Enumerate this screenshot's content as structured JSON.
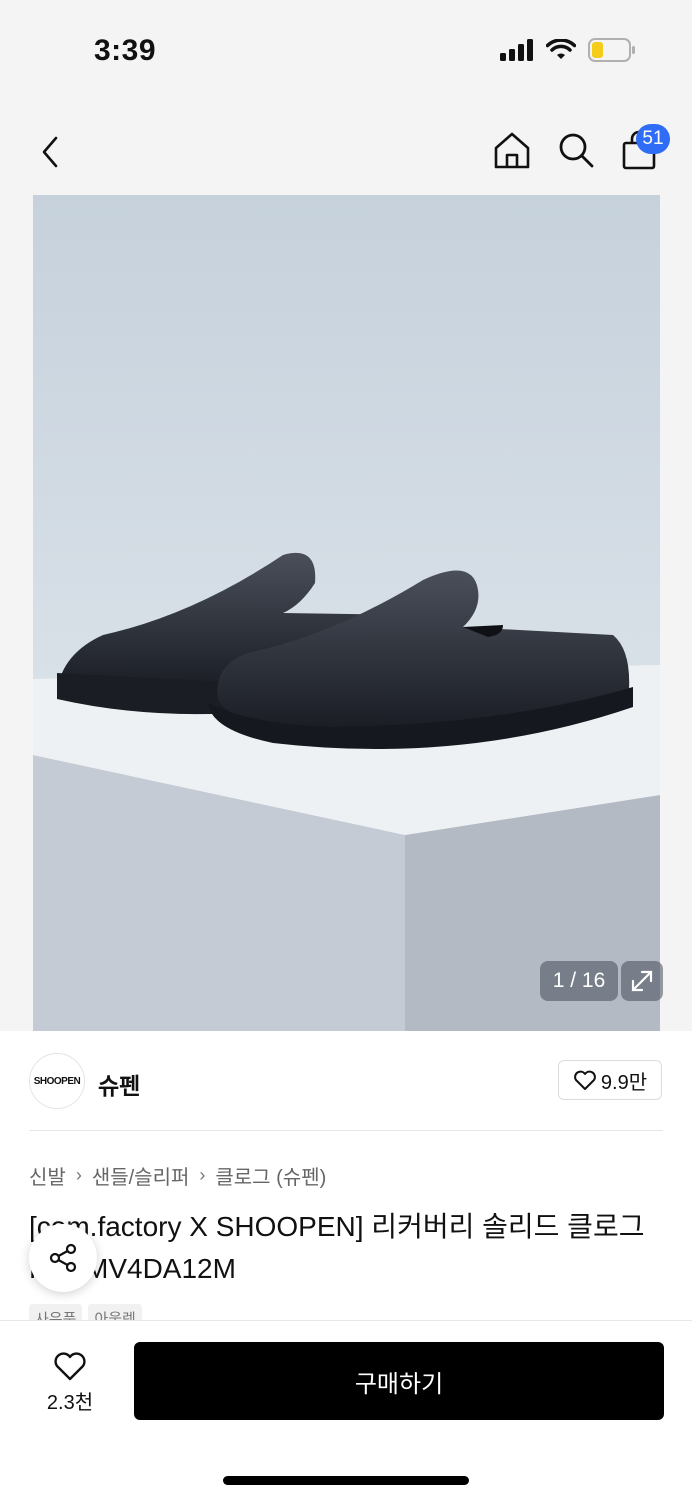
{
  "status": {
    "time": "3:39"
  },
  "nav": {
    "back_icon": "chevron-left-icon",
    "home_icon": "home-icon",
    "search_icon": "search-icon",
    "cart_icon": "shopping-bag-icon",
    "cart_count": "51",
    "badge_color": "#2f6df6"
  },
  "gallery": {
    "counter": "1 / 16",
    "expand_icon": "expand-arrows-icon"
  },
  "brand": {
    "logo_text": "SHOOPEN",
    "name": "슈펜",
    "likes": "9.9만"
  },
  "breadcrumb": [
    "신발",
    "샌들/슬리퍼",
    "클로그 (슈펜)"
  ],
  "product": {
    "title": "[com.factory X SHOOPEN] 리커버리 솔리드 클로그 FHPMV4DA12M",
    "tags": [
      "사은품",
      "아울렛"
    ]
  },
  "bottom": {
    "wish_count": "2.3천",
    "buy_label": "구매하기",
    "buy_color": "#000000"
  }
}
